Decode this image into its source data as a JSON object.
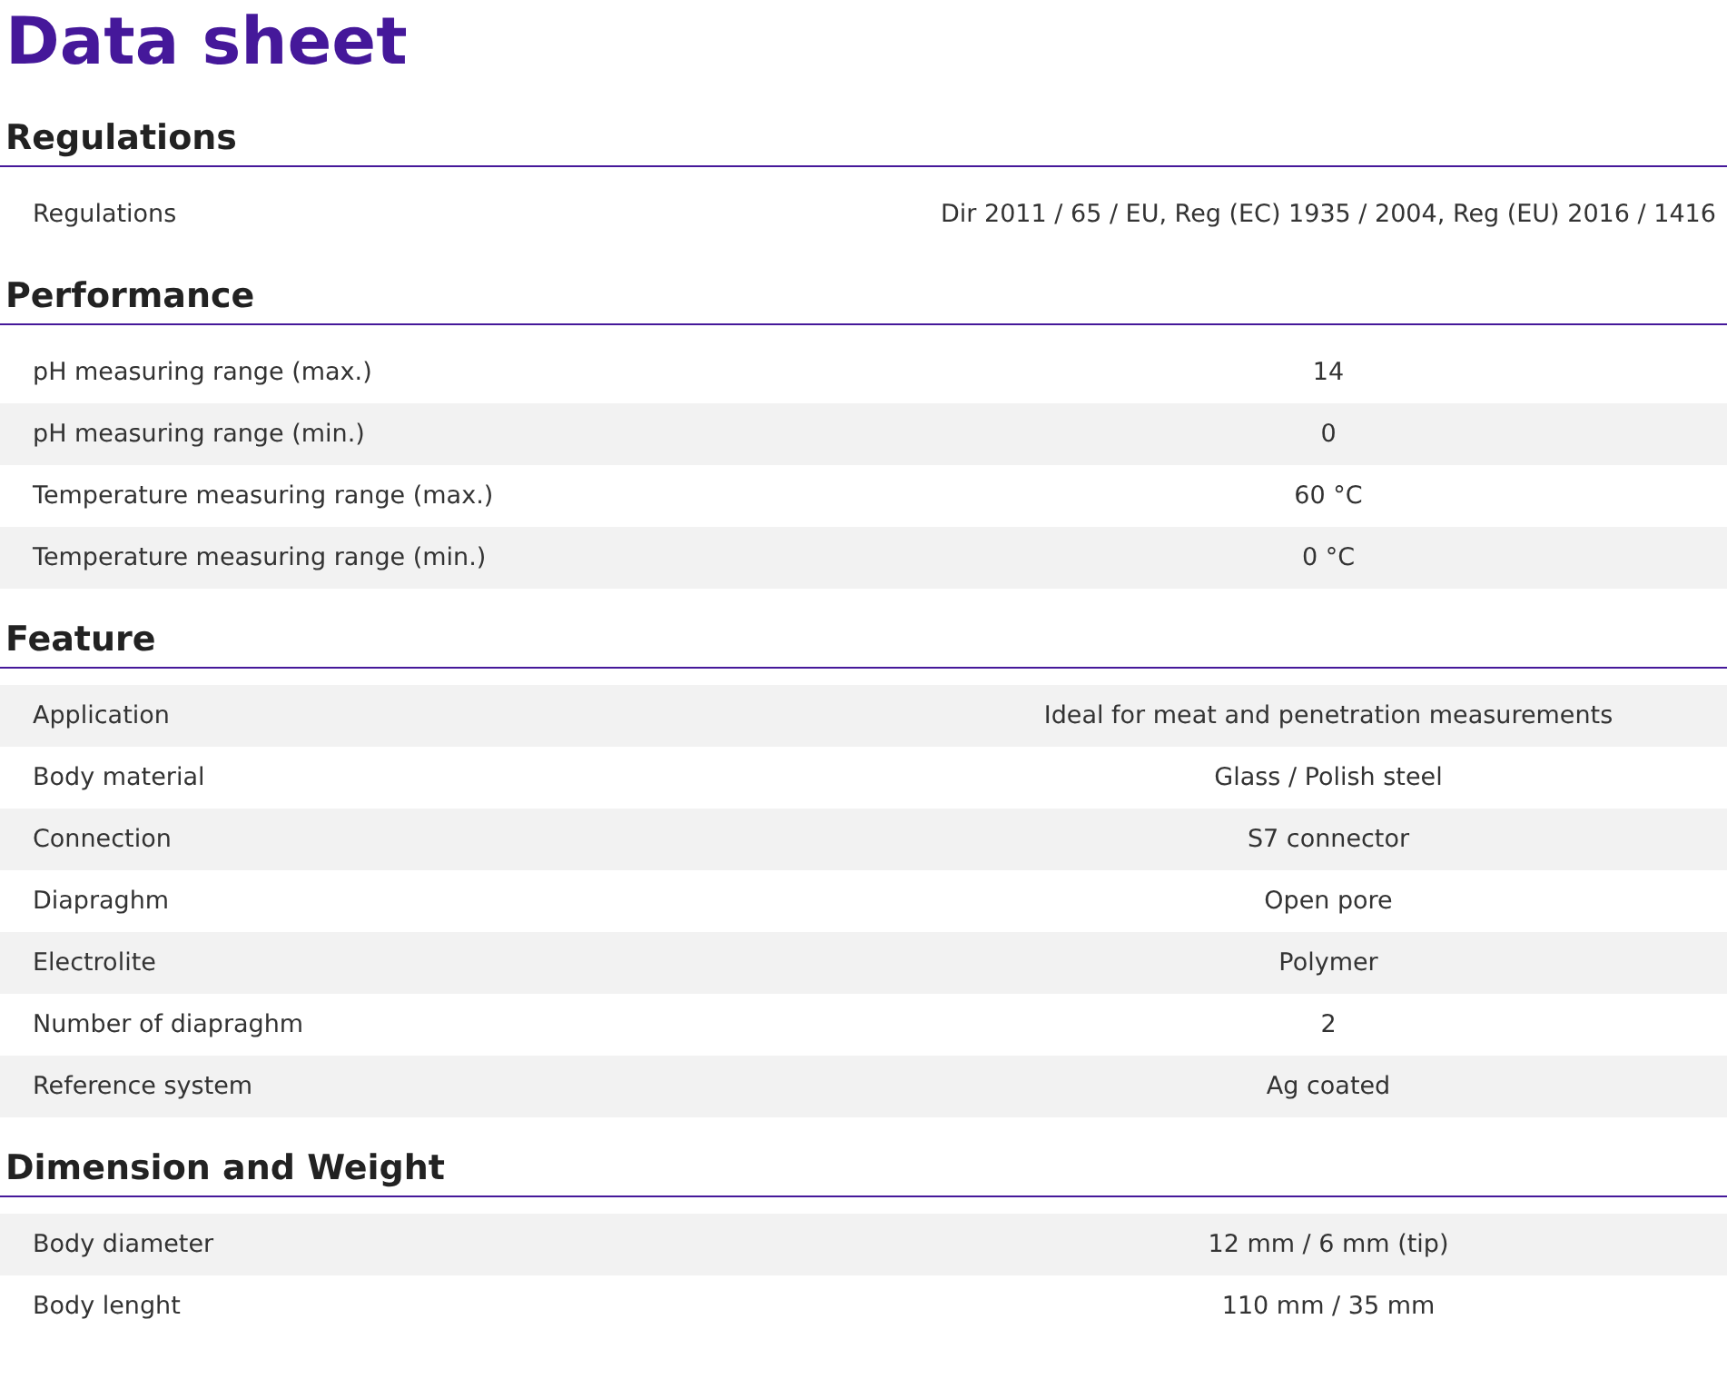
{
  "title": "Data sheet",
  "sections": [
    {
      "heading": "Regulations",
      "rows": [
        {
          "label": "Regulations",
          "value": "Dir 2011 / 65 / EU, Reg (EC) 1935 / 2004, Reg (EU) 2016 / 1416",
          "shaded": false
        }
      ]
    },
    {
      "heading": "Performance",
      "rows": [
        {
          "label": "pH measuring range (max.)",
          "value": "14",
          "shaded": false
        },
        {
          "label": "pH measuring range (min.)",
          "value": "0",
          "shaded": true
        },
        {
          "label": "Temperature measuring range (max.)",
          "value": "60 °C",
          "shaded": false
        },
        {
          "label": "Temperature measuring range (min.)",
          "value": "0 °C",
          "shaded": true
        }
      ]
    },
    {
      "heading": "Feature",
      "rows": [
        {
          "label": "Application",
          "value": "Ideal for meat and penetration measurements",
          "shaded": true
        },
        {
          "label": "Body material",
          "value": "Glass / Polish steel",
          "shaded": false
        },
        {
          "label": "Connection",
          "value": "S7 connector",
          "shaded": true
        },
        {
          "label": "Diapraghm",
          "value": "Open pore",
          "shaded": false
        },
        {
          "label": "Electrolite",
          "value": "Polymer",
          "shaded": true
        },
        {
          "label": "Number of diapraghm",
          "value": "2",
          "shaded": false
        },
        {
          "label": "Reference system",
          "value": "Ag coated",
          "shaded": true
        }
      ]
    },
    {
      "heading": "Dimension and Weight",
      "rows": [
        {
          "label": "Body diameter",
          "value": "12 mm / 6 mm (tip)",
          "shaded": true
        },
        {
          "label": "Body lenght",
          "value": "110 mm / 35 mm",
          "shaded": false
        }
      ]
    }
  ]
}
